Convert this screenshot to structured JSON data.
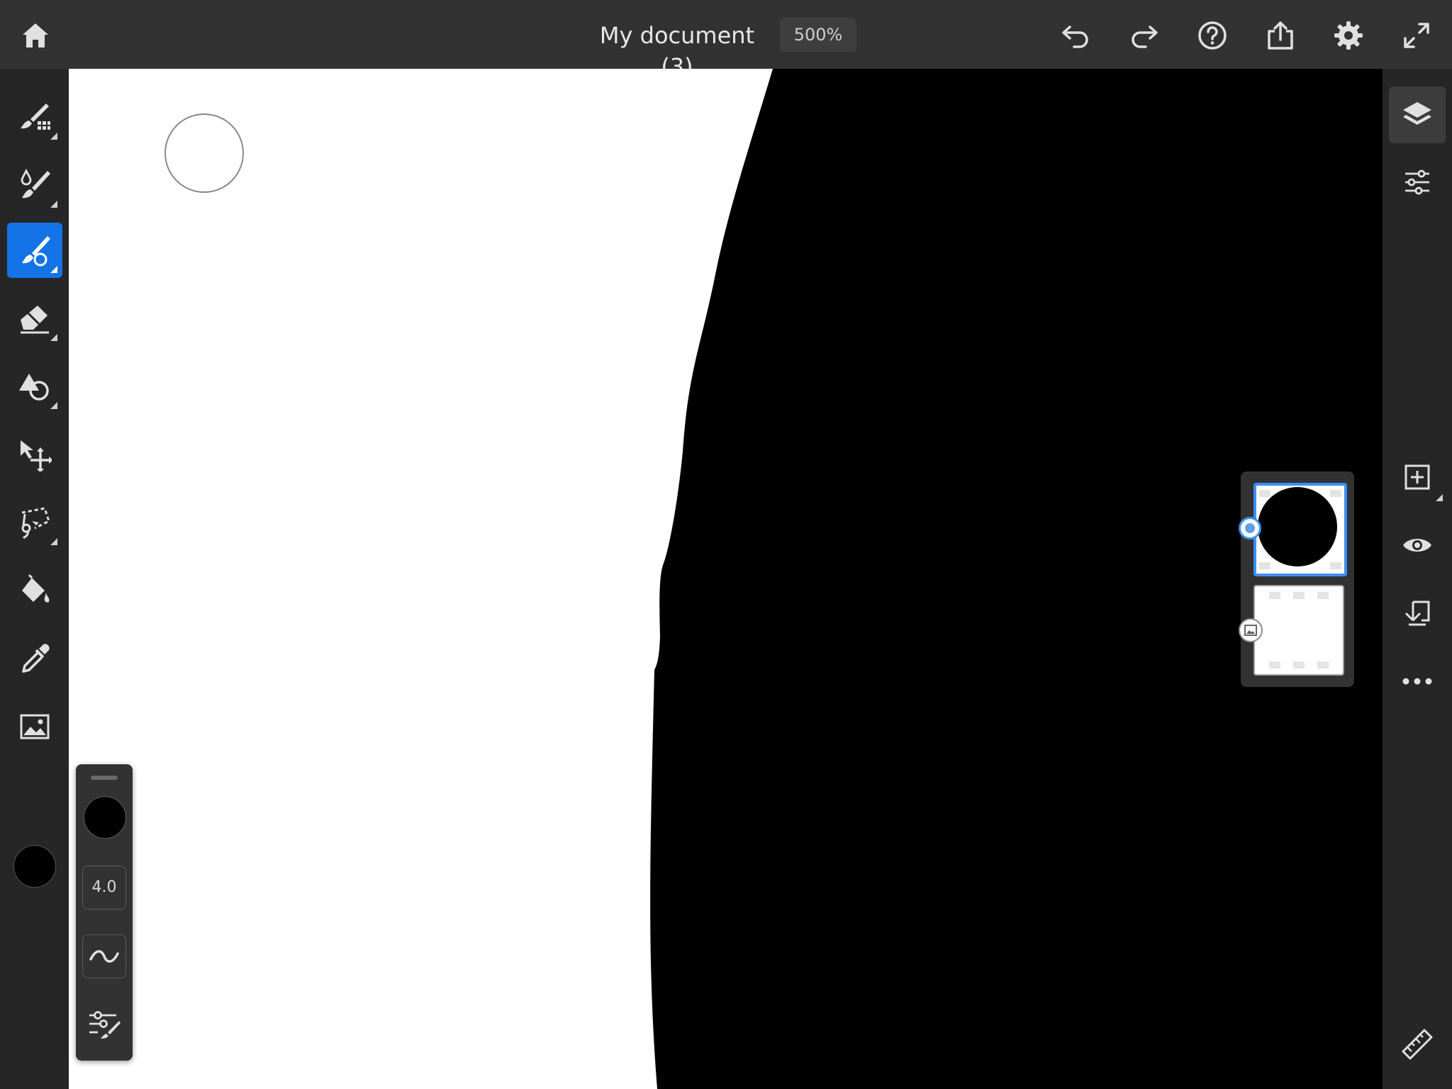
{
  "document": {
    "title": "My document (3)",
    "zoom": "500%"
  },
  "top_bar": {
    "icons": [
      "home-icon",
      "undo-icon",
      "redo-icon",
      "help-icon",
      "share-icon",
      "settings-icon",
      "fullscreen-icon"
    ]
  },
  "left_toolbar": {
    "tools": [
      {
        "name": "pixel-brush-icon",
        "active": false
      },
      {
        "name": "watercolor-brush-icon",
        "active": false
      },
      {
        "name": "live-brush-icon",
        "active": true
      },
      {
        "name": "eraser-icon",
        "active": false
      },
      {
        "name": "shapes-icon",
        "active": false
      },
      {
        "name": "transform-icon",
        "active": false
      },
      {
        "name": "lasso-icon",
        "active": false
      },
      {
        "name": "fill-icon",
        "active": false
      },
      {
        "name": "eyedropper-icon",
        "active": false
      },
      {
        "name": "image-icon",
        "active": false
      }
    ],
    "color": "#000000"
  },
  "brush_panel": {
    "size": "4.0",
    "color": "#000000"
  },
  "right_toolbar": {
    "tools": [
      "layers-icon",
      "properties-icon",
      "add-layer-icon",
      "visibility-icon",
      "merge-down-icon",
      "more-icon",
      "ruler-icon"
    ]
  },
  "layers": [
    {
      "name": "drawing-layer",
      "selected": true
    },
    {
      "name": "background-layer",
      "selected": false
    }
  ],
  "colors": {
    "accent": "#1473e6",
    "selection": "#3d8ef5",
    "paint": "#000000"
  }
}
